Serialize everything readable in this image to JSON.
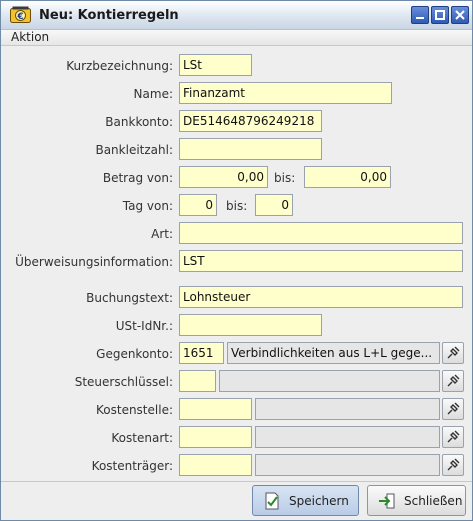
{
  "window": {
    "title": "Neu: Kontierregeln"
  },
  "menu": {
    "items": [
      "Aktion"
    ]
  },
  "form": {
    "kurzbezeichnung": {
      "label": "Kurzbezeichnung:",
      "value": "LSt"
    },
    "name": {
      "label": "Name:",
      "value": "Finanzamt"
    },
    "bankkonto": {
      "label": "Bankkonto:",
      "value": "DE514648796249218"
    },
    "bankleitzahl": {
      "label": "Bankleitzahl:",
      "value": ""
    },
    "betrag": {
      "label": "Betrag von:",
      "from": "0,00",
      "bis_label": "bis:",
      "to": "0,00"
    },
    "tag": {
      "label": "Tag von:",
      "from": "0",
      "bis_label": "bis:",
      "to": "0"
    },
    "art": {
      "label": "Art:",
      "value": ""
    },
    "ueberweisungsinformation": {
      "label": "Überweisungsinformation:",
      "value": "LST"
    },
    "buchungstext": {
      "label": "Buchungstext:",
      "value": "Lohnsteuer"
    },
    "ustidnr": {
      "label": "USt-IdNr.:",
      "value": ""
    },
    "gegenkonto": {
      "label": "Gegenkonto:",
      "code": "1651",
      "description": "Verbindlichkeiten aus L+L gege..."
    },
    "steuerschluessel": {
      "label": "Steuerschlüssel:",
      "code": "",
      "description": ""
    },
    "kostenstelle": {
      "label": "Kostenstelle:",
      "code": "",
      "description": ""
    },
    "kostenart": {
      "label": "Kostenart:",
      "code": "",
      "description": ""
    },
    "kostentraeger": {
      "label": "Kostenträger:",
      "code": "",
      "description": ""
    }
  },
  "buttons": {
    "save": "Speichern",
    "close": "Schließen"
  },
  "colors": {
    "field_bg": "#ffffcc",
    "title_buttons": "#2f5bb5"
  }
}
